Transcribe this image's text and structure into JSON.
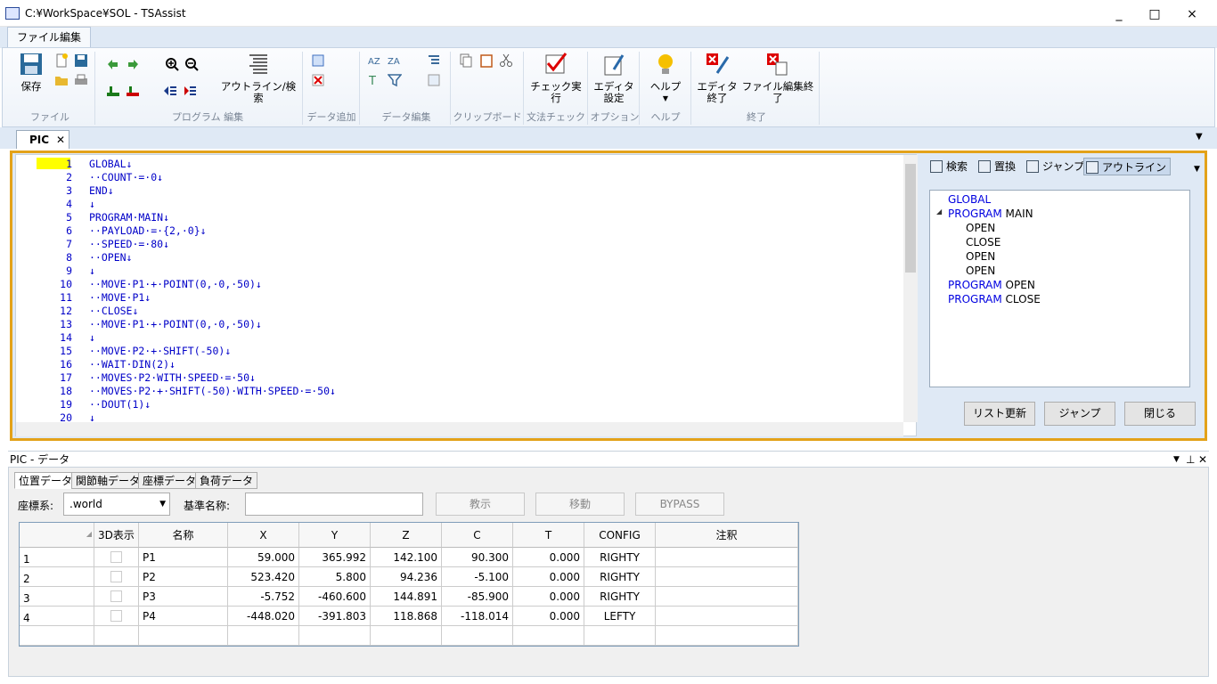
{
  "window": {
    "title": "C:¥WorkSpace¥SOL  - TSAssist",
    "minimize": "_",
    "maximize": "□",
    "close": "×"
  },
  "ribbon": {
    "tab": "ファイル編集",
    "save": "保存",
    "outline_search": "アウトライン/検索",
    "check_run": "チェック実行",
    "editor_settings": [
      "エディタ",
      "設定"
    ],
    "help": "ヘルプ",
    "editor_exit": [
      "エディタ",
      "終了"
    ],
    "file_edit_exit": "ファイル編集終了",
    "groups": [
      "ファイル",
      "プログラム 編集",
      "データ追加",
      "データ編集",
      "クリップボード",
      "文法チェック",
      "オプション",
      "ヘルプ",
      "終了"
    ]
  },
  "doc_tab": {
    "label": "PIC",
    "close": "✕"
  },
  "editor": {
    "line_numbers": [
      "1",
      "2",
      "3",
      "4",
      "5",
      "6",
      "7",
      "8",
      "9",
      "10",
      "11",
      "12",
      "13",
      "14",
      "15",
      "16",
      "17",
      "18",
      "19",
      "20"
    ],
    "lines": [
      "GLOBAL↓",
      "··COUNT·=·0↓",
      "END↓",
      "↓",
      "PROGRAM·MAIN↓",
      "··PAYLOAD·=·{2,·0}↓",
      "··SPEED·=·80↓",
      "··OPEN↓",
      "↓",
      "··MOVE·P1·+·POINT(0,·0,·50)↓",
      "··MOVE·P1↓",
      "··CLOSE↓",
      "··MOVE·P1·+·POINT(0,·0,·50)↓",
      "↓",
      "··MOVE·P2·+·SHIFT(-50)↓",
      "··WAIT·DIN(2)↓",
      "··MOVES·P2·WITH·SPEED·=·50↓",
      "··MOVES·P2·+·SHIFT(-50)·WITH·SPEED·=·50↓",
      "··DOUT(1)↓",
      "↓"
    ]
  },
  "side": {
    "tabs": [
      "検索",
      "置換",
      "ジャンプ",
      "アウトライン"
    ],
    "outline": [
      {
        "kw": "GLOBAL",
        "name": ""
      },
      {
        "kw": "PROGRAM",
        "name": " MAIN"
      },
      {
        "kw": "",
        "name": "OPEN"
      },
      {
        "kw": "",
        "name": "CLOSE"
      },
      {
        "kw": "",
        "name": "OPEN"
      },
      {
        "kw": "",
        "name": "OPEN"
      },
      {
        "kw": "PROGRAM",
        "name": " OPEN"
      },
      {
        "kw": "PROGRAM",
        "name": " CLOSE"
      }
    ],
    "expand": "◢",
    "buttons": [
      "リスト更新",
      "ジャンプ",
      "閉じる"
    ]
  },
  "data_panel": {
    "title": "PIC - データ",
    "tabs": [
      "位置データ",
      "関節軸データ",
      "座標データ",
      "負荷データ"
    ],
    "coord_label": "座標系:",
    "coord_value": ".world",
    "base_label": "基準名称:",
    "buttons": [
      "教示",
      "移動",
      "BYPASS"
    ],
    "columns": [
      "3D表示",
      "名称",
      "X",
      "Y",
      "Z",
      "C",
      "T",
      "CONFIG",
      "注釈"
    ],
    "rows": [
      {
        "no": "1",
        "name": "P1",
        "x": "59.000",
        "y": "365.992",
        "z": "142.100",
        "c": "90.300",
        "t": "0.000",
        "config": "RIGHTY"
      },
      {
        "no": "2",
        "name": "P2",
        "x": "523.420",
        "y": "5.800",
        "z": "94.236",
        "c": "-5.100",
        "t": "0.000",
        "config": "RIGHTY"
      },
      {
        "no": "3",
        "name": "P3",
        "x": "-5.752",
        "y": "-460.600",
        "z": "144.891",
        "c": "-85.900",
        "t": "0.000",
        "config": "RIGHTY"
      },
      {
        "no": "4",
        "name": "P4",
        "x": "-448.020",
        "y": "-391.803",
        "z": "118.868",
        "c": "-118.014",
        "t": "0.000",
        "config": "LEFTY"
      }
    ]
  },
  "colors": {
    "accent": "#e3a21a",
    "keyword": "#0000c8",
    "number": "#8000a0",
    "line_highlight": "#ffff00"
  }
}
